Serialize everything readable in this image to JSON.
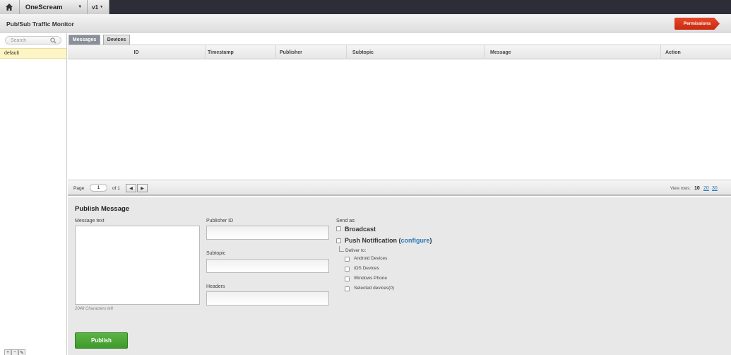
{
  "topbar": {
    "app_name": "OneScream",
    "version": "v1"
  },
  "header": {
    "title": "Pub/Sub Traffic Monitor",
    "permissions_label": "Permissions"
  },
  "sidebar": {
    "search_placeholder": "Search",
    "items": [
      {
        "label": "default"
      }
    ],
    "buttons": [
      "+",
      "−",
      "✎"
    ]
  },
  "tabs": [
    {
      "label": "Messages",
      "active": true
    },
    {
      "label": "Devices",
      "active": false
    }
  ],
  "table": {
    "columns": [
      "ID",
      "Timestamp",
      "Publisher",
      "Subtopic",
      "Message",
      "Action"
    ],
    "rows": []
  },
  "pager": {
    "page_label": "Page",
    "page_value": "1",
    "of_label": "of 1",
    "view_rows_label": "View rows:",
    "row_options": [
      "10",
      "20",
      "30"
    ],
    "selected_rows": "10"
  },
  "publish": {
    "title": "Publish Message",
    "message_text_label": "Message text",
    "chars_left": "2048 Characters left",
    "publisher_id_label": "Publisher ID",
    "subtopic_label": "Subtopic",
    "headers_label": "Headers",
    "send_as_label": "Send as:",
    "broadcast_label": "Broadcast",
    "push_label": "Push Notification",
    "configure_label": "configure",
    "deliver_to_label": "Deliver to:",
    "devices": [
      "Android Devices",
      "iOS Devices",
      "Windows Phone",
      "Selected devices(0)"
    ],
    "publish_button": "Publish"
  },
  "colors": {
    "topbar": "#2b2e36",
    "permissions": "#d43a1c",
    "publish_button": "#4ea63a",
    "selected_row": "#fdf5c4",
    "link": "#2a7ab8"
  }
}
